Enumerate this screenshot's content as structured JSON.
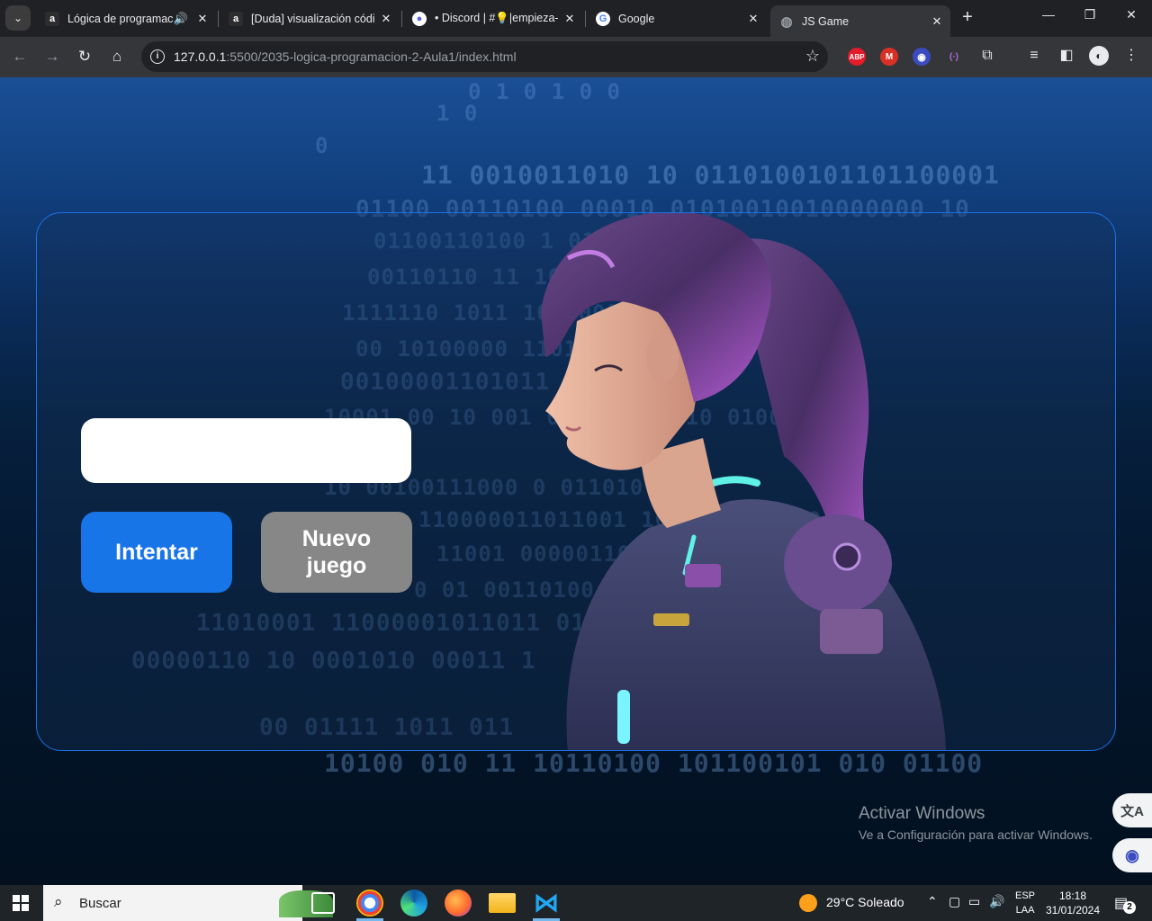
{
  "browser": {
    "tabs": [
      {
        "title": "Lógica de programac",
        "favicon_text": "a",
        "favicon_color": "#2d2d2d",
        "audio": true
      },
      {
        "title": "[Duda] visualización códi",
        "favicon_text": "a",
        "favicon_color": "#2d2d2d"
      },
      {
        "title": "• Discord | #💡|empieza-",
        "favicon_text": "●",
        "favicon_color": "#5865f2"
      },
      {
        "title": "Google",
        "favicon_text": "G",
        "favicon_color": "#ffffff"
      },
      {
        "title": "JS Game",
        "favicon_text": "◍",
        "favicon_color": "#5f6368",
        "active": true
      }
    ],
    "new_tab_label": "+",
    "window_controls": {
      "minimize": "—",
      "restore": "❐",
      "close": "✕"
    },
    "address": {
      "host": "127.0.0.1",
      "path": ":5500/2035-logica-programacion-2-Aula1/index.html"
    },
    "extensions": [
      {
        "name": "adblock-plus",
        "label": "ABP",
        "color": "#e21c2a"
      },
      {
        "name": "gmail",
        "label": "M",
        "color": "#d93025"
      },
      {
        "name": "assistant",
        "label": "◉",
        "color": "#3b4cc0"
      },
      {
        "name": "sound",
        "label": "(·)",
        "color": "#8a3ab9"
      }
    ]
  },
  "game": {
    "input_value": "",
    "try_button": "Intentar",
    "new_game_line1": "Nuevo",
    "new_game_line2": "juego",
    "accent": "#1875e8",
    "secondary": "#878787"
  },
  "binary_bg": [
    "0 1 0 1 0 0",
    "1 0",
    "0",
    "11 0010011010 10 0110100101101100001",
    "01100 00110100 00010 01010010010000000 10",
    "01100110100 1 011011 1 0 0",
    "00110110 11 10110100000010",
    "1111110 1011 100000011 0 0",
    "00 10100000 11011 001011",
    "00100001101011 0 01 01",
    "10001 00 10 001 010 10011010 0100011 00",
    "10 00100111000 0 011010",
    "110000011011001 1001111 01000",
    "11001 00000110 0100011 0",
    "0 01 00110100 00110 0 1010",
    "11010001 11000001011011 010 11 100",
    "00000110 10 0001010 00011 1",
    "00 01111 1011 011",
    "10100 010 11 10110100 101100101 010 01100"
  ],
  "windows": {
    "activate_title": "Activar Windows",
    "activate_sub": "Ve a Configuración para activar Windows."
  },
  "taskbar": {
    "search_placeholder": "Buscar",
    "weather": "29°C  Soleado",
    "lang_top": "ESP",
    "lang_bottom": "LAA",
    "time": "18:18",
    "date": "31/01/2024",
    "notifications": "2"
  }
}
